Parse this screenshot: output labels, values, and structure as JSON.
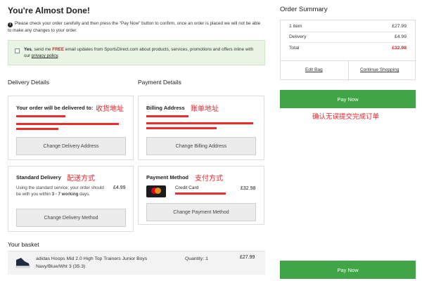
{
  "page": {
    "title": "You're Almost Done!",
    "notice": "Please check your order carefully and then press the \"Pay Now\" button to confirm, once an order is placed we will not be able to make any changes to your order."
  },
  "optin": {
    "yes": "Yes",
    "text_before": ", send me ",
    "free": "FREE",
    "text_after": " email updates from SportsDirect.com about products, services, promotions and offers inline with our ",
    "policy_link": "privacy policy",
    "end": "."
  },
  "delivery": {
    "section_title": "Delivery Details",
    "address_card": {
      "title": "Your order will be delivered to:",
      "annotation": "收货地址",
      "button": "Change Delivery Address"
    },
    "method_card": {
      "title": "Standard Delivery",
      "annotation": "配送方式",
      "price": "£4.99",
      "desc_prefix": "Using the standard service, your order should be with you within ",
      "desc_bold": "3 - 7 working",
      "desc_suffix": " days.",
      "button": "Change Delivery Method"
    }
  },
  "payment": {
    "section_title": "Payment Details",
    "billing_card": {
      "title": "Billing Address",
      "annotation": "账单地址",
      "button": "Change Billing Address"
    },
    "method_card": {
      "title": "Payment Method",
      "annotation": "支付方式",
      "card_label": "Credit Card",
      "price": "£32.98",
      "button": "Change Payment Method"
    }
  },
  "basket": {
    "title": "Your basket",
    "items": [
      {
        "name": "adidas Hoops Mid 2.0 High Top Trainers Junior Boys",
        "variant": "Navy/Blue/Wht 3 (35.3)",
        "quantity": "Quantity: 1",
        "price": "£27.99"
      }
    ]
  },
  "summary": {
    "title": "Order Summary",
    "rows": [
      {
        "label": "1 item",
        "value": "£27.99"
      },
      {
        "label": "Delivery",
        "value": "£4.99"
      },
      {
        "label": "Total",
        "value": "£32.98"
      }
    ],
    "edit_bag": "Edit Bag",
    "continue_shopping": "Continue Shopping",
    "pay_now": "Pay Now",
    "annotation": "确认无误提交完成订单"
  },
  "colors": {
    "accent_green": "#41a548",
    "annotation_red": "#e8242b",
    "total_red": "#d81f26"
  }
}
